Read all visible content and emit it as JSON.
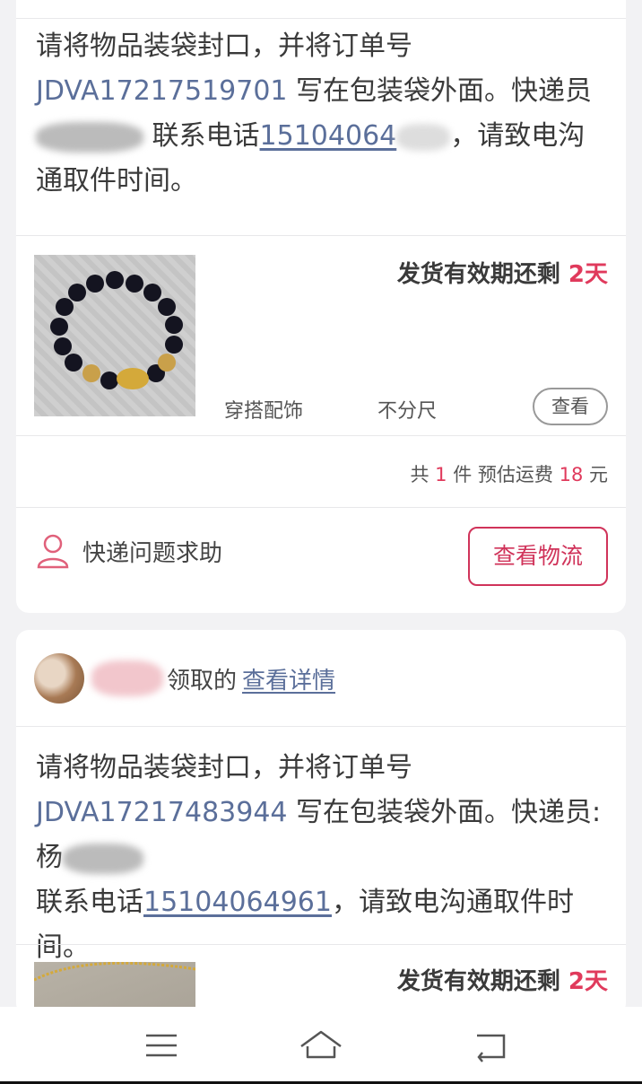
{
  "orders": [
    {
      "instruction": {
        "part1": "请将物品装袋封口，并将订单号 ",
        "order_no": "JDVA17217519701",
        "part2": " 写在包装袋外面。快递员",
        "part3": " 联系电话",
        "phone": "15104064",
        "part4": "，请致电沟通取件时间。"
      },
      "product": {
        "deadline_prefix": "发货有效期还剩 ",
        "deadline_value": "2天",
        "category": "穿搭配饰",
        "size": "不分尺",
        "view_label": "查看"
      },
      "summary": {
        "prefix": "共 ",
        "count": "1",
        "mid": " 件 预估运费 ",
        "fee": "18",
        "suffix": " 元"
      },
      "help_label": "快递问题求助",
      "logistics_label": "查看物流"
    },
    {
      "claim": {
        "text": "领取的",
        "link": "查看详情"
      },
      "instruction": {
        "part1": "请将物品装袋封口，并将订单号 ",
        "order_no": "JDVA17217483944",
        "part2": " 写在包装袋外面。快递员:杨",
        "part3": "联系电话",
        "phone": "15104064961",
        "part4": "，请致电沟通取件时间。"
      },
      "product": {
        "deadline_prefix": "发货有效期还剩 ",
        "deadline_value": "2天"
      }
    }
  ],
  "colors": {
    "accent_red": "#e03a5c",
    "link_blue": "#5b6f9a",
    "button_border": "#d0335a"
  },
  "icons": [
    "user-outline-icon",
    "menu-icon",
    "home-icon",
    "back-icon"
  ]
}
